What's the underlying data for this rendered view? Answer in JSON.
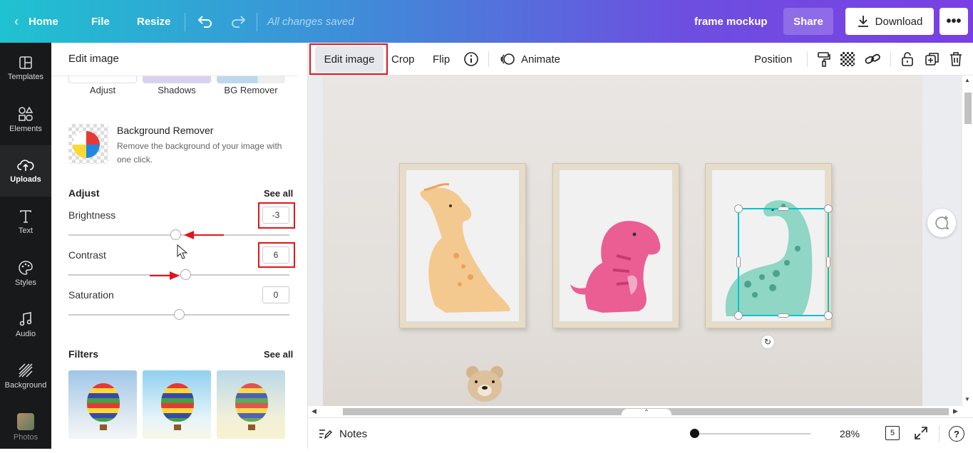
{
  "topbar": {
    "home_label": "Home",
    "file_label": "File",
    "resize_label": "Resize",
    "save_status": "All changes saved",
    "doc_title": "frame mockup",
    "share_label": "Share",
    "download_label": "Download"
  },
  "rail": {
    "items": [
      {
        "label": "Templates",
        "icon": "templates-icon"
      },
      {
        "label": "Elements",
        "icon": "elements-icon"
      },
      {
        "label": "Uploads",
        "icon": "upload-cloud-icon"
      },
      {
        "label": "Text",
        "icon": "text-icon"
      },
      {
        "label": "Styles",
        "icon": "palette-icon"
      },
      {
        "label": "Audio",
        "icon": "music-note-icon"
      },
      {
        "label": "Background",
        "icon": "background-icon"
      },
      {
        "label": "Photos",
        "icon": "photos-icon"
      }
    ]
  },
  "panel": {
    "title": "Edit image",
    "tools": [
      "Adjust",
      "Shadows",
      "BG Remover"
    ],
    "bg_remover": {
      "title": "Background Remover",
      "description_line1": "Remove the background of your image with",
      "description_line2": "one click."
    },
    "adjust": {
      "heading": "Adjust",
      "see_all": "See all",
      "sliders": [
        {
          "label": "Brightness",
          "value": "-3"
        },
        {
          "label": "Contrast",
          "value": "6"
        },
        {
          "label": "Saturation",
          "value": "0"
        }
      ]
    },
    "filters": {
      "heading": "Filters",
      "see_all": "See all"
    }
  },
  "toolbar": {
    "edit_image": "Edit image",
    "crop": "Crop",
    "flip": "Flip",
    "animate": "Animate",
    "position": "Position"
  },
  "bottom": {
    "notes": "Notes",
    "zoom": "28%",
    "page_count": "5"
  },
  "colors": {
    "accent_red": "#e3141b",
    "selection": "#00c4cc"
  }
}
